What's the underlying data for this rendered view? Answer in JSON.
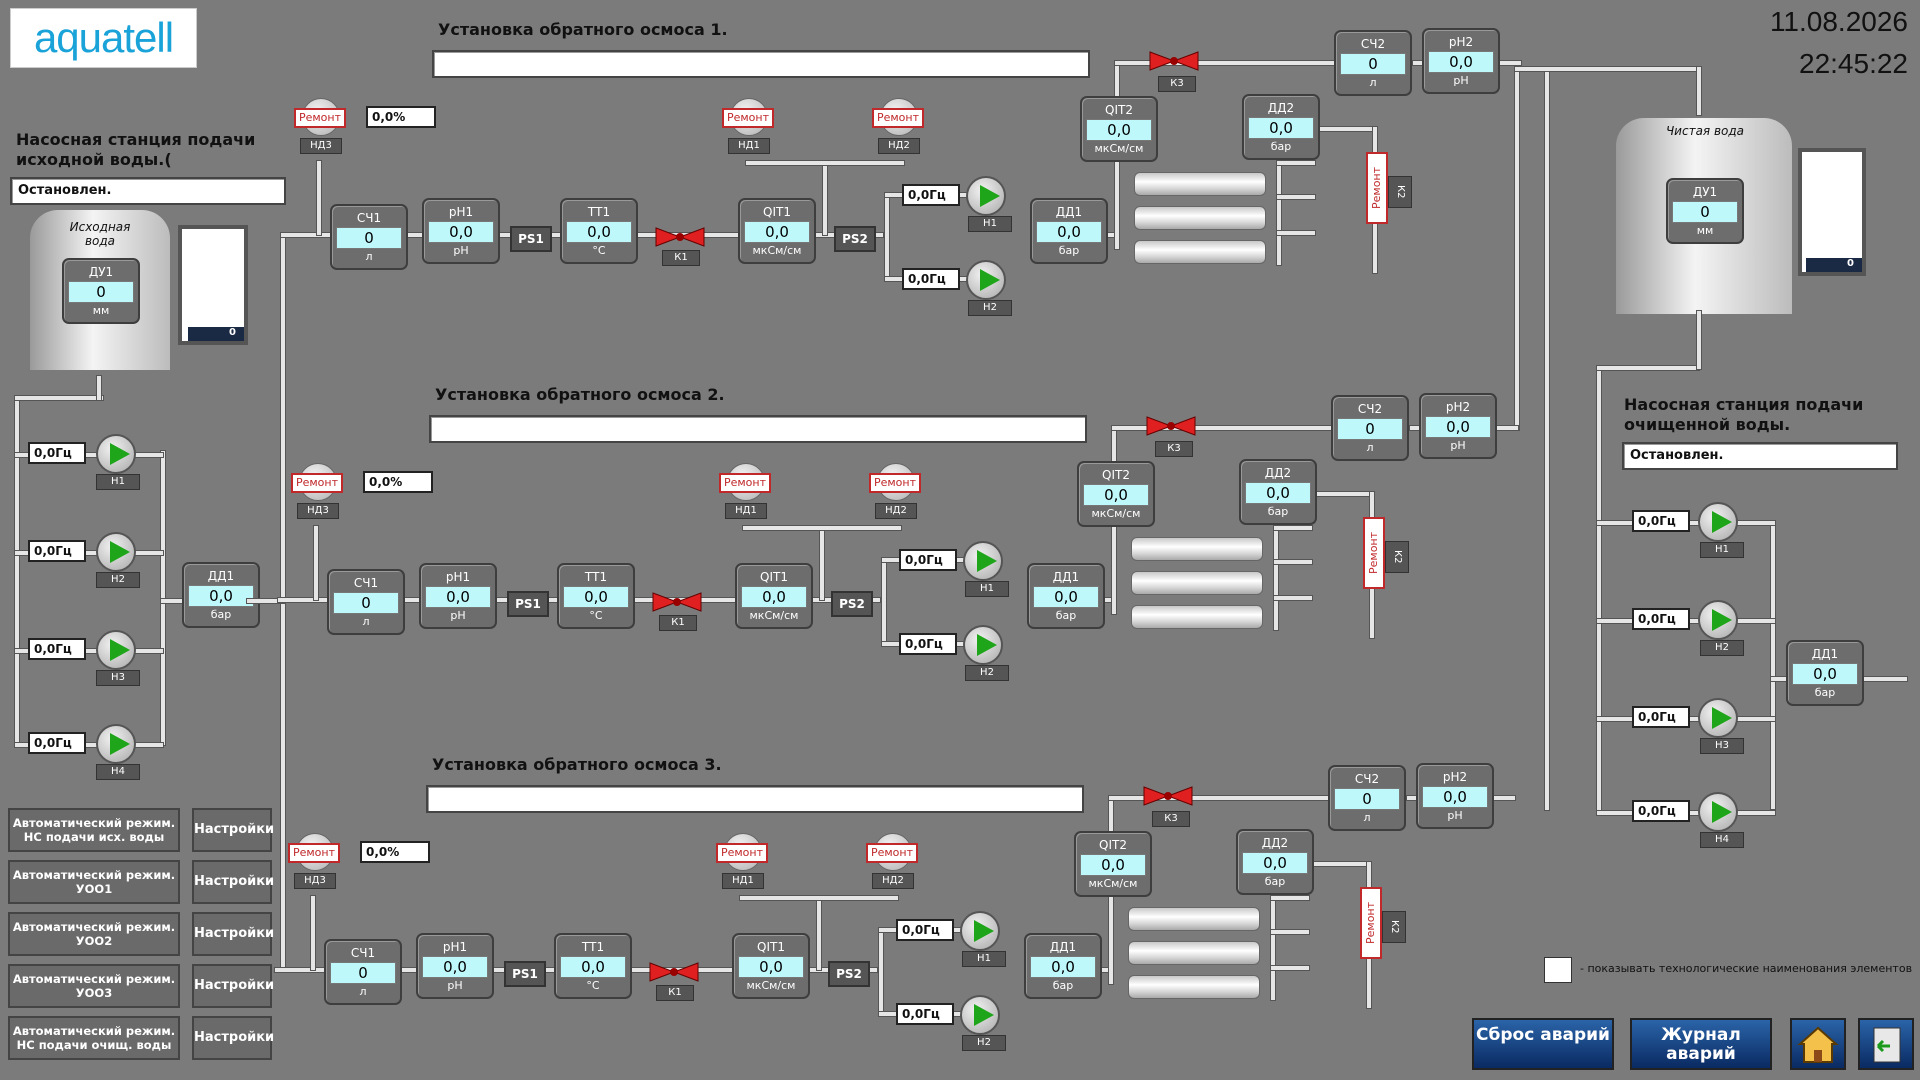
{
  "header": {
    "logo": "aquatell",
    "date": "11.08.2026",
    "time": "22:45:22"
  },
  "left_station": {
    "title": "Насосная станция подачи исходной воды.(",
    "status": "Остановлен.",
    "tank_label": "Исходная вода",
    "level": {
      "name": "ДУ1",
      "value": "0",
      "unit": "мм"
    },
    "level_indicator": "0",
    "pumps": [
      {
        "hz": "0,0Гц",
        "tag": "Н1"
      },
      {
        "hz": "0,0Гц",
        "tag": "Н2"
      },
      {
        "hz": "0,0Гц",
        "tag": "Н3"
      },
      {
        "hz": "0,0Гц",
        "tag": "Н4"
      }
    ],
    "pressure": {
      "name": "ДД1",
      "value": "0,0",
      "unit": "бар"
    }
  },
  "right_station": {
    "title": "Насосная станция подачи очищенной воды.",
    "status": "Остановлен.",
    "tank_label": "Чистая вода",
    "level": {
      "name": "ДУ1",
      "value": "0",
      "unit": "мм"
    },
    "level_indicator": "0",
    "pumps": [
      {
        "hz": "0,0Гц",
        "tag": "Н1"
      },
      {
        "hz": "0,0Гц",
        "tag": "Н2"
      },
      {
        "hz": "0,0Гц",
        "tag": "Н3"
      },
      {
        "hz": "0,0Гц",
        "tag": "Н4"
      }
    ],
    "pressure": {
      "name": "ДД1",
      "value": "0,0",
      "unit": "бар"
    }
  },
  "units": [
    {
      "title": "Установка обратного осмоса 1.",
      "status": "",
      "nd3": {
        "tag": "НД3",
        "repair": "Ремонт",
        "pct": "0,0%"
      },
      "sch1": {
        "name": "СЧ1",
        "value": "0",
        "unit": "л"
      },
      "ph1": {
        "name": "pH1",
        "value": "0,0",
        "unit": "pH"
      },
      "ps1": "PS1",
      "tt1": {
        "name": "ТТ1",
        "value": "0,0",
        "unit": "°C"
      },
      "k1": "К1",
      "nd1": {
        "tag": "НД1",
        "repair": "Ремонт"
      },
      "nd2": {
        "tag": "НД2",
        "repair": "Ремонт"
      },
      "qit1": {
        "name": "QIT1",
        "value": "0,0",
        "unit": "мкСм/см"
      },
      "ps2": "PS2",
      "h1": {
        "hz": "0,0Гц",
        "tag": "Н1"
      },
      "h2": {
        "hz": "0,0Гц",
        "tag": "Н2"
      },
      "dd1": {
        "name": "ДД1",
        "value": "0,0",
        "unit": "бар"
      },
      "qit2": {
        "name": "QIT2",
        "value": "0,0",
        "unit": "мкСм/см"
      },
      "dd2": {
        "name": "ДД2",
        "value": "0,0",
        "unit": "бар"
      },
      "k3": "К3",
      "k2": {
        "tag": "К2",
        "repair": "Ремонт"
      },
      "sch2": {
        "name": "СЧ2",
        "value": "0",
        "unit": "л"
      },
      "ph2": {
        "name": "pH2",
        "value": "0,0",
        "unit": "pH"
      }
    },
    {
      "title": "Установка обратного осмоса 2.",
      "status": "",
      "nd3": {
        "tag": "НД3",
        "repair": "Ремонт",
        "pct": "0,0%"
      },
      "sch1": {
        "name": "СЧ1",
        "value": "0",
        "unit": "л"
      },
      "ph1": {
        "name": "pH1",
        "value": "0,0",
        "unit": "pH"
      },
      "ps1": "PS1",
      "tt1": {
        "name": "ТТ1",
        "value": "0,0",
        "unit": "°C"
      },
      "k1": "К1",
      "nd1": {
        "tag": "НД1",
        "repair": "Ремонт"
      },
      "nd2": {
        "tag": "НД2",
        "repair": "Ремонт"
      },
      "qit1": {
        "name": "QIT1",
        "value": "0,0",
        "unit": "мкСм/см"
      },
      "ps2": "PS2",
      "h1": {
        "hz": "0,0Гц",
        "tag": "Н1"
      },
      "h2": {
        "hz": "0,0Гц",
        "tag": "Н2"
      },
      "dd1": {
        "name": "ДД1",
        "value": "0,0",
        "unit": "бар"
      },
      "qit2": {
        "name": "QIT2",
        "value": "0,0",
        "unit": "мкСм/см"
      },
      "dd2": {
        "name": "ДД2",
        "value": "0,0",
        "unit": "бар"
      },
      "k3": "К3",
      "k2": {
        "tag": "К2",
        "repair": "Ремонт"
      },
      "sch2": {
        "name": "СЧ2",
        "value": "0",
        "unit": "л"
      },
      "ph2": {
        "name": "pH2",
        "value": "0,0",
        "unit": "pH"
      }
    },
    {
      "title": "Установка обратного осмоса 3.",
      "status": "",
      "nd3": {
        "tag": "НД3",
        "repair": "Ремонт",
        "pct": "0,0%"
      },
      "sch1": {
        "name": "СЧ1",
        "value": "0",
        "unit": "л"
      },
      "ph1": {
        "name": "pH1",
        "value": "0,0",
        "unit": "pH"
      },
      "ps1": "PS1",
      "tt1": {
        "name": "ТТ1",
        "value": "0,0",
        "unit": "°C"
      },
      "k1": "К1",
      "nd1": {
        "tag": "НД1",
        "repair": "Ремонт"
      },
      "nd2": {
        "tag": "НД2",
        "repair": "Ремонт"
      },
      "qit1": {
        "name": "QIT1",
        "value": "0,0",
        "unit": "мкСм/см"
      },
      "ps2": "PS2",
      "h1": {
        "hz": "0,0Гц",
        "tag": "Н1"
      },
      "h2": {
        "hz": "0,0Гц",
        "tag": "Н2"
      },
      "dd1": {
        "name": "ДД1",
        "value": "0,0",
        "unit": "бар"
      },
      "qit2": {
        "name": "QIT2",
        "value": "0,0",
        "unit": "мкСм/см"
      },
      "dd2": {
        "name": "ДД2",
        "value": "0,0",
        "unit": "бар"
      },
      "k3": "К3",
      "k2": {
        "tag": "К2",
        "repair": "Ремонт"
      },
      "sch2": {
        "name": "СЧ2",
        "value": "0",
        "unit": "л"
      },
      "ph2": {
        "name": "pH2",
        "value": "0,0",
        "unit": "pH"
      }
    }
  ],
  "mode_buttons": [
    {
      "label": "Автоматический режим. НС подачи исх. воды",
      "settings": "Настройки"
    },
    {
      "label": "Автоматический режим. УОО1",
      "settings": "Настройки"
    },
    {
      "label": "Автоматический режим. УОО2",
      "settings": "Настройки"
    },
    {
      "label": "Автоматический режим. УОО3",
      "settings": "Настройки"
    },
    {
      "label": "Автоматический режим. НС подачи очищ. воды",
      "settings": "Настройки"
    }
  ],
  "footer": {
    "show_names_hint": "- показывать технологические наименования элементов",
    "reset_alarms": "Сброс аварий",
    "alarm_log": "Журнал аварий",
    "home_icon": "home-icon",
    "exit_icon": "exit-icon"
  },
  "colors": {
    "background": "#7b7b7b",
    "value_field": "#bff8fb",
    "pump_on": "#1fa51a",
    "valve": "#e02020",
    "repair": "#c0282a",
    "button_blue": "#0a2a62"
  }
}
